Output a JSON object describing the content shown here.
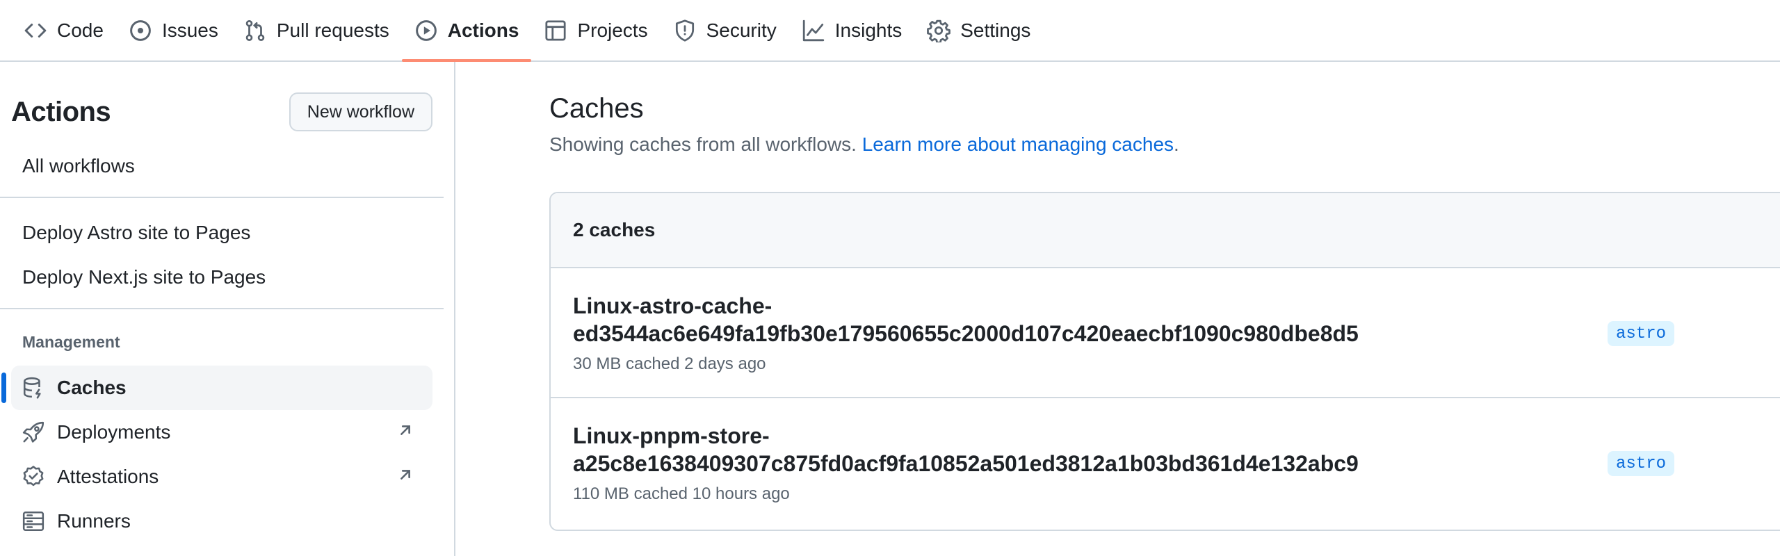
{
  "nav": {
    "tabs": [
      {
        "label": "Code",
        "icon": "code-icon"
      },
      {
        "label": "Issues",
        "icon": "issue-opened-icon"
      },
      {
        "label": "Pull requests",
        "icon": "git-pull-request-icon"
      },
      {
        "label": "Actions",
        "icon": "play-icon",
        "active": true
      },
      {
        "label": "Projects",
        "icon": "table-icon"
      },
      {
        "label": "Security",
        "icon": "shield-icon"
      },
      {
        "label": "Insights",
        "icon": "graph-icon"
      },
      {
        "label": "Settings",
        "icon": "gear-icon"
      }
    ],
    "active_underline_color": "#fd8c73"
  },
  "sidebar": {
    "title": "Actions",
    "new_workflow_label": "New workflow",
    "all_workflows": "All workflows",
    "workflows": [
      "Deploy Astro site to Pages",
      "Deploy Next.js site to Pages"
    ],
    "management": {
      "heading": "Management",
      "items": [
        {
          "label": "Caches",
          "icon": "database-icon",
          "active": true
        },
        {
          "label": "Deployments",
          "icon": "rocket-icon",
          "external": true
        },
        {
          "label": "Attestations",
          "icon": "verified-icon",
          "external": true
        },
        {
          "label": "Runners",
          "icon": "server-icon"
        }
      ]
    }
  },
  "main": {
    "title": "Caches",
    "subtitle": "Showing caches from all workflows.",
    "learn_more": "Learn more about managing caches",
    "learn_more_suffix": ".",
    "count_label": "2 caches",
    "caches": [
      {
        "key_line1": "Linux-astro-cache-",
        "key_line2": "ed3544ac6e649fa19fb30e179560655c2000d107c420eaecbf1090c980dbe8d5",
        "meta": "30 MB cached 2 days ago",
        "branch": "astro"
      },
      {
        "key_line1": "Linux-pnpm-store-",
        "key_line2": "a25c8e1638409307c875fd0acf9fa10852a501ed3812a1b03bd361d4e132abc9",
        "meta": "110 MB cached 10 hours ago",
        "branch": "astro"
      }
    ]
  },
  "colors": {
    "accent": "#0969da",
    "border": "#d1d9e0",
    "muted_text": "#59636e",
    "badge_bg": "#ddf4ff"
  }
}
